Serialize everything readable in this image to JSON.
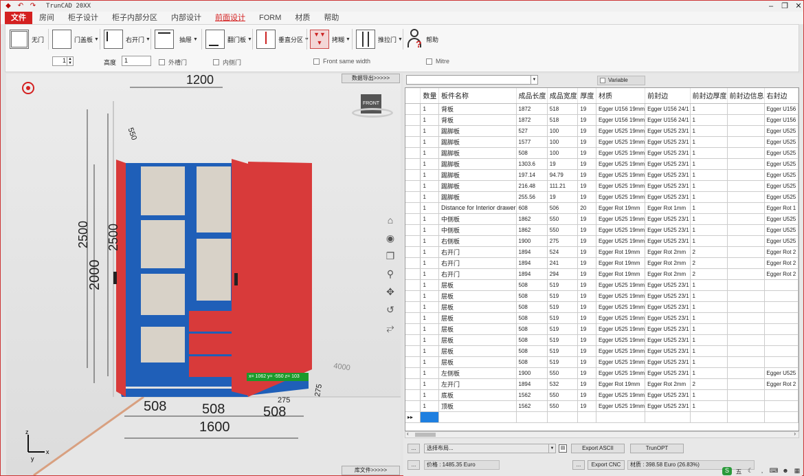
{
  "app": {
    "title": "TrunCAD 20XX"
  },
  "menu": [
    "文件",
    "房间",
    "柜子设计",
    "柜子内部分区",
    "内部设计",
    "前面设计",
    "FORM",
    "材质",
    "帮助"
  ],
  "ribbon": {
    "buttons": [
      "无门",
      "门盖板",
      "右开门",
      "抽屉",
      "翻门板",
      "垂直分区",
      "拷糊",
      "推拉门",
      "帮助"
    ],
    "height_label": "高度",
    "height_value": "1",
    "spinner_value": "1",
    "checkboxes": [
      "外槽门",
      "内侧门",
      "Front same width",
      "Mitre"
    ]
  },
  "viewport": {
    "export_button": "数据导出>>>>>",
    "library_button": "库文件>>>>>",
    "view_cube_label": "FRONT",
    "coord_readout": "x= 1062 y= -550 z= 103",
    "dimensions": {
      "top_width": "1200",
      "depth_top": "550",
      "height_outer": "2500",
      "height_inner": "2500",
      "height_body": "2000",
      "bottom_left": "508",
      "bottom_mid": "508",
      "bottom_right": "508",
      "bottom_total": "1600",
      "side_small": "275",
      "corner_small": "275",
      "floor": "4000"
    },
    "axis": {
      "x": "x",
      "y": "y",
      "z": "z"
    }
  },
  "panel": {
    "dropdown_value": "",
    "variable_label": "Variable",
    "columns": [
      "数量",
      "板件名称",
      "成品长度",
      "成品宽度",
      "厚度",
      "材质",
      "前封边",
      "前封边厚度",
      "前封边信息",
      "右封边"
    ],
    "rows": [
      [
        "1",
        "背板",
        "1872",
        "518",
        "19",
        "Egger U156 19mm",
        "Egger U156 24/1",
        "1",
        "",
        "Egger U156"
      ],
      [
        "1",
        "背板",
        "1872",
        "518",
        "19",
        "Egger U156 19mm",
        "Egger U156 24/1",
        "1",
        "",
        "Egger U156"
      ],
      [
        "1",
        "踢脚板",
        "527",
        "100",
        "19",
        "Egger U525 19mm",
        "Egger U525 23/1",
        "1",
        "",
        "Egger U525"
      ],
      [
        "1",
        "踢脚板",
        "1577",
        "100",
        "19",
        "Egger U525 19mm",
        "Egger U525 23/1",
        "1",
        "",
        "Egger U525"
      ],
      [
        "1",
        "踢脚板",
        "508",
        "100",
        "19",
        "Egger U525 19mm",
        "Egger U525 23/1",
        "1",
        "",
        "Egger U525"
      ],
      [
        "1",
        "踢脚板",
        "1303.6",
        "19",
        "19",
        "Egger U525 19mm",
        "Egger U525 23/1",
        "1",
        "",
        "Egger U525"
      ],
      [
        "1",
        "踢脚板",
        "197.14",
        "94.79",
        "19",
        "Egger U525 19mm",
        "Egger U525 23/1",
        "1",
        "",
        "Egger U525"
      ],
      [
        "1",
        "踢脚板",
        "216.48",
        "111.21",
        "19",
        "Egger U525 19mm",
        "Egger U525 23/1",
        "1",
        "",
        "Egger U525"
      ],
      [
        "1",
        "踢脚板",
        "255.56",
        "19",
        "19",
        "Egger U525 19mm",
        "Egger U525 23/1",
        "1",
        "",
        "Egger U525"
      ],
      [
        "1",
        "Distance for Interior drawer",
        "608",
        "506",
        "20",
        "Egger Rot 19mm",
        "Egger Rot 1mm",
        "1",
        "",
        "Egger Rot 1"
      ],
      [
        "1",
        "中侧板",
        "1862",
        "550",
        "19",
        "Egger U525 19mm",
        "Egger U525 23/1",
        "1",
        "",
        "Egger U525"
      ],
      [
        "1",
        "中侧板",
        "1862",
        "550",
        "19",
        "Egger U525 19mm",
        "Egger U525 23/1",
        "1",
        "",
        "Egger U525"
      ],
      [
        "1",
        "右侧板",
        "1900",
        "275",
        "19",
        "Egger U525 19mm",
        "Egger U525 23/1",
        "1",
        "",
        "Egger U525"
      ],
      [
        "1",
        "右开门",
        "1894",
        "524",
        "19",
        "Egger Rot 19mm",
        "Egger Rot 2mm",
        "2",
        "",
        "Egger Rot 2"
      ],
      [
        "1",
        "右开门",
        "1894",
        "241",
        "19",
        "Egger Rot 19mm",
        "Egger Rot 2mm",
        "2",
        "",
        "Egger Rot 2"
      ],
      [
        "1",
        "右开门",
        "1894",
        "294",
        "19",
        "Egger Rot 19mm",
        "Egger Rot 2mm",
        "2",
        "",
        "Egger Rot 2"
      ],
      [
        "1",
        "层板",
        "508",
        "519",
        "19",
        "Egger U525 19mm",
        "Egger U525 23/1",
        "1",
        "",
        ""
      ],
      [
        "1",
        "层板",
        "508",
        "519",
        "19",
        "Egger U525 19mm",
        "Egger U525 23/1",
        "1",
        "",
        ""
      ],
      [
        "1",
        "层板",
        "508",
        "519",
        "19",
        "Egger U525 19mm",
        "Egger U525 23/1",
        "1",
        "",
        ""
      ],
      [
        "1",
        "层板",
        "508",
        "519",
        "19",
        "Egger U525 19mm",
        "Egger U525 23/1",
        "1",
        "",
        ""
      ],
      [
        "1",
        "层板",
        "508",
        "519",
        "19",
        "Egger U525 19mm",
        "Egger U525 23/1",
        "1",
        "",
        ""
      ],
      [
        "1",
        "层板",
        "508",
        "519",
        "19",
        "Egger U525 19mm",
        "Egger U525 23/1",
        "1",
        "",
        ""
      ],
      [
        "1",
        "层板",
        "508",
        "519",
        "19",
        "Egger U525 19mm",
        "Egger U525 23/1",
        "1",
        "",
        ""
      ],
      [
        "1",
        "层板",
        "508",
        "519",
        "19",
        "Egger U525 19mm",
        "Egger U525 23/1",
        "1",
        "",
        ""
      ],
      [
        "1",
        "左侧板",
        "1900",
        "550",
        "19",
        "Egger U525 19mm",
        "Egger U525 23/1",
        "1",
        "",
        "Egger U525"
      ],
      [
        "1",
        "左开门",
        "1894",
        "532",
        "19",
        "Egger Rot 19mm",
        "Egger Rot 2mm",
        "2",
        "",
        "Egger Rot 2"
      ],
      [
        "1",
        "底板",
        "1562",
        "550",
        "19",
        "Egger U525 19mm",
        "Egger U525 23/1",
        "1",
        "",
        ""
      ],
      [
        "1",
        "顶板",
        "1562",
        "550",
        "19",
        "Egger U525 19mm",
        "Egger U525 23/1",
        "1",
        "",
        ""
      ]
    ],
    "new_row_marker": "▸▸",
    "layout_select": "选择布局...",
    "export_ascii": "Export ASCII",
    "trunopt": "TrunOPT",
    "export_cnc": "Export CNC",
    "ellipsis": "...",
    "price": "价格 : 1485.35 Euro",
    "material": "材质 : 398.58 Euro (26.83%)"
  },
  "colors": {
    "accent": "#d42020",
    "cabinet_blue": "#1f5fb8",
    "cabinet_red": "#d83a3a",
    "coord_green": "#1a9a2a"
  },
  "icons": [
    "undo-icon",
    "redo-icon",
    "eye-icon",
    "home-icon",
    "zoom-icon",
    "pan-icon",
    "rotate-icon",
    "fit-icon",
    "help-person-icon"
  ]
}
